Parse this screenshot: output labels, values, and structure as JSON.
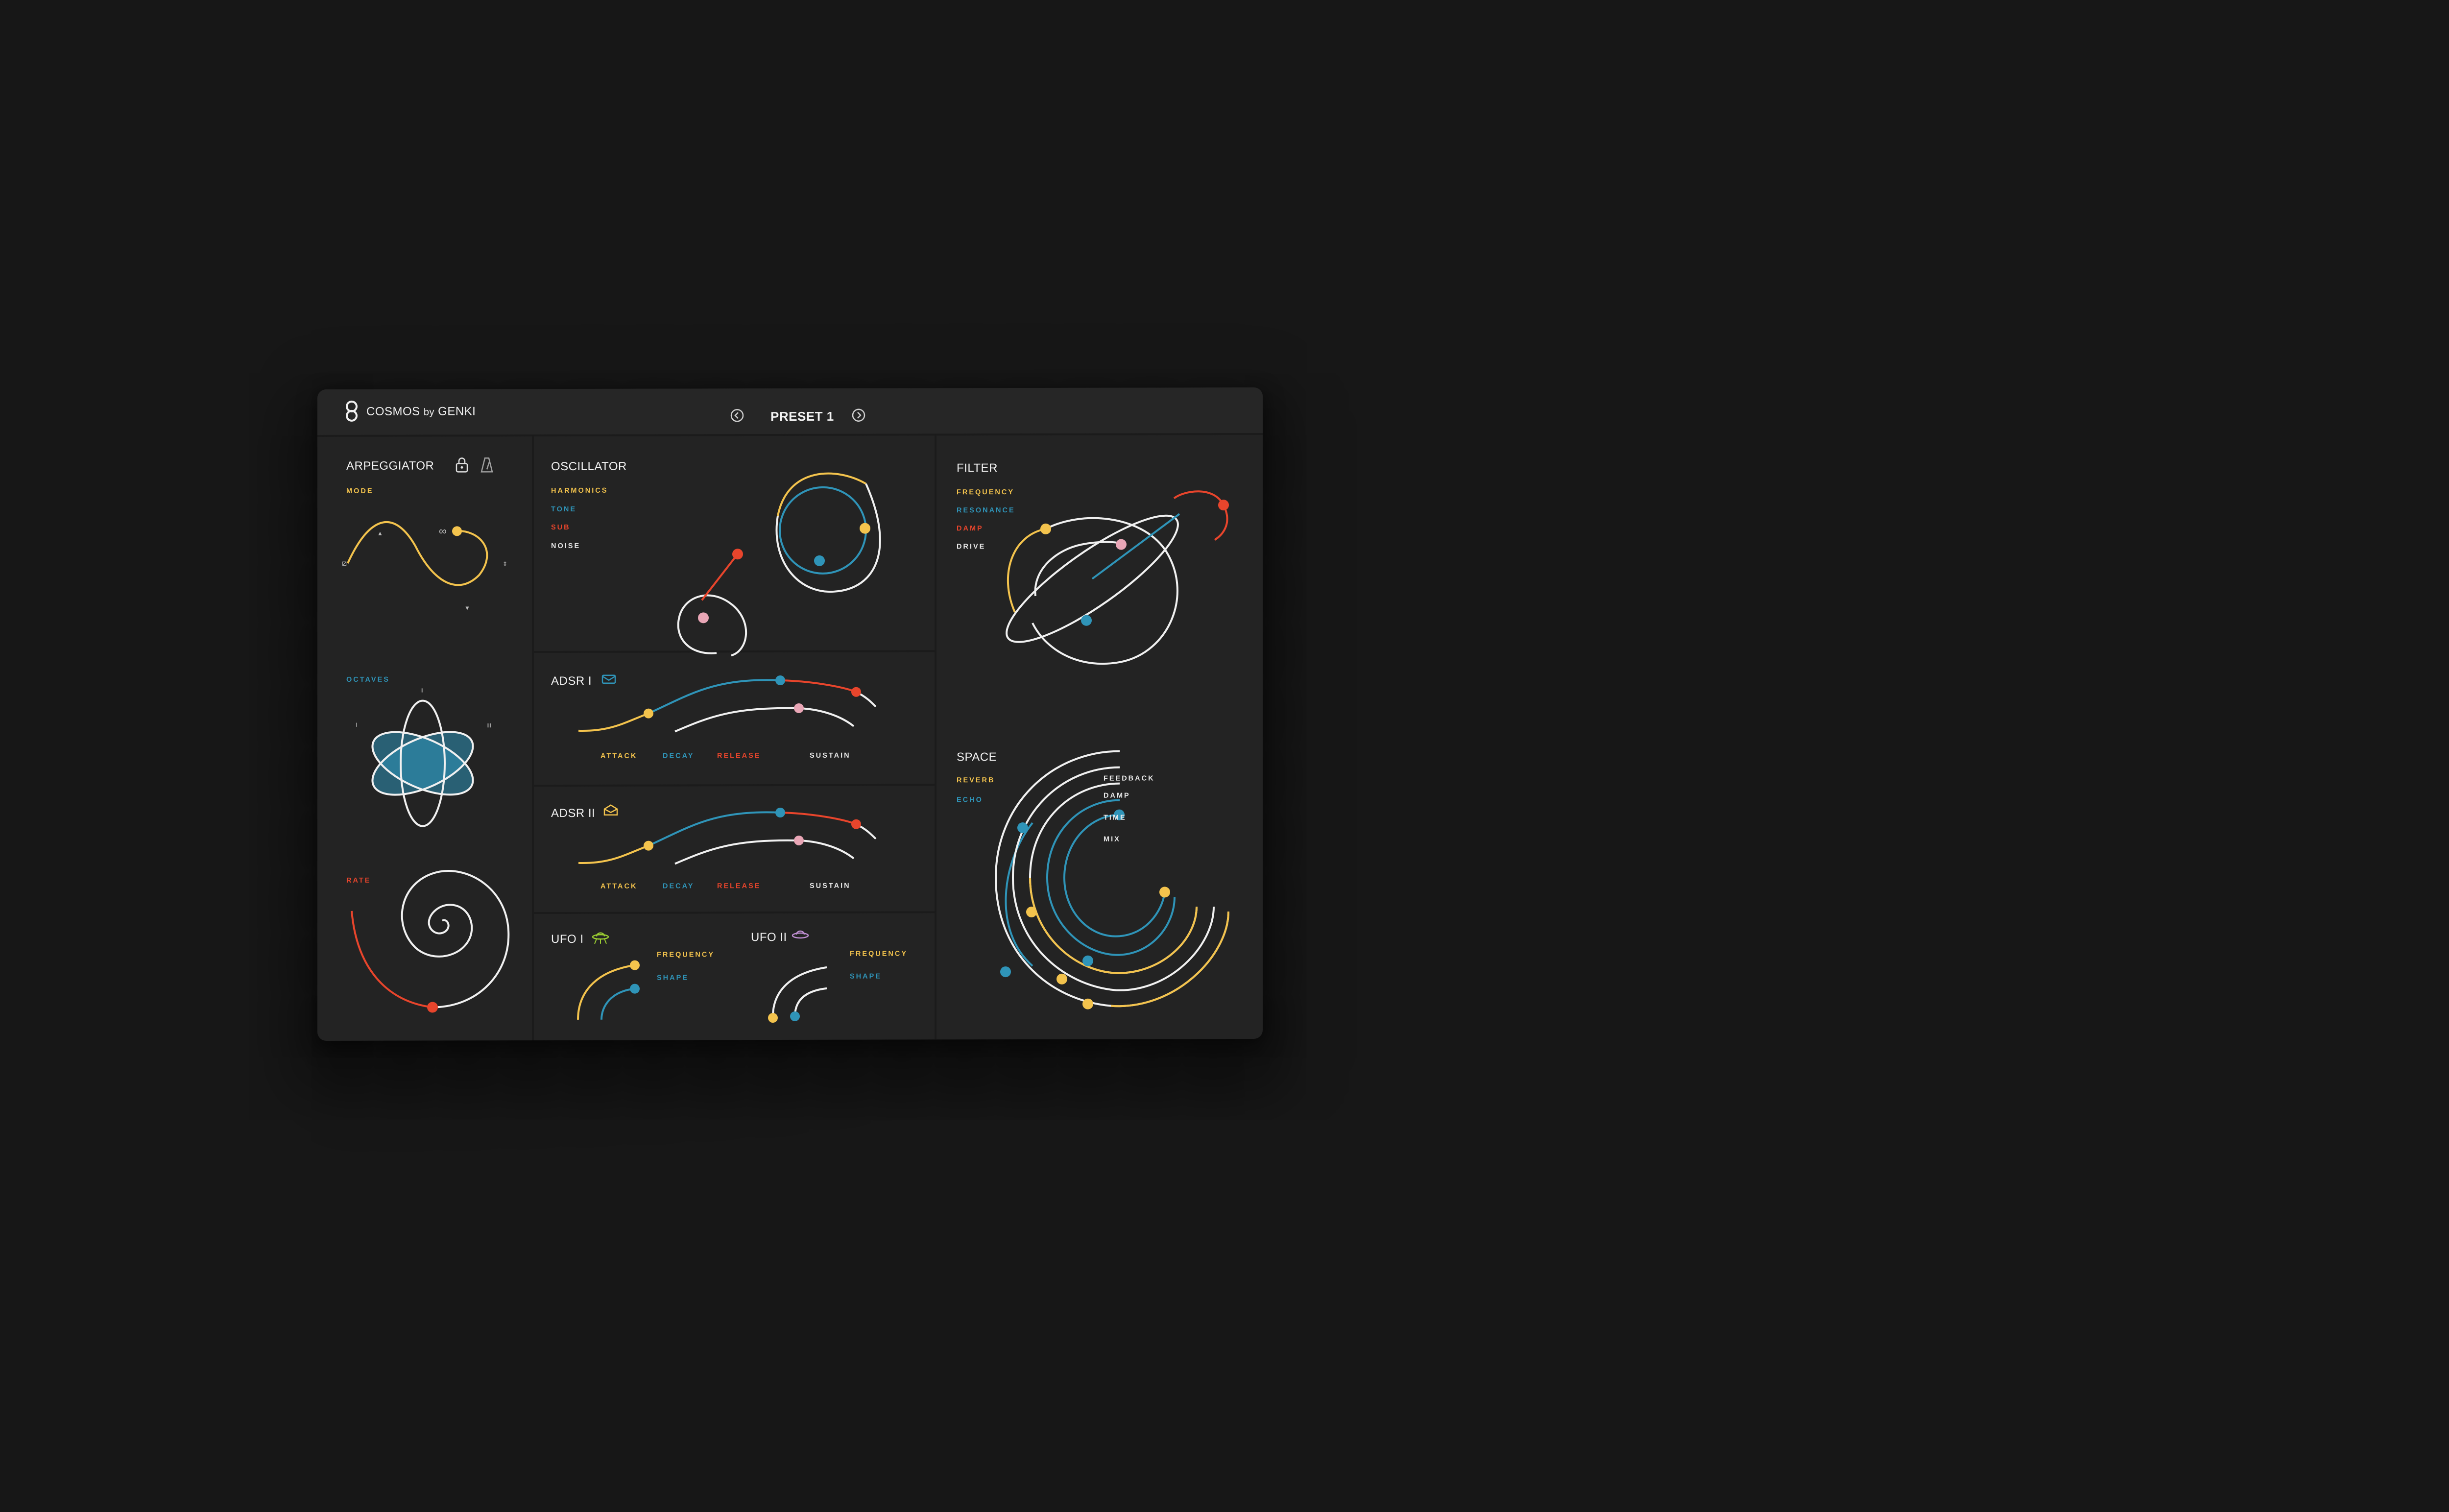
{
  "header": {
    "brand": "COSMOS",
    "brand_by": "by",
    "brand_maker": "GENKI",
    "preset_name": "PRESET 1"
  },
  "colors": {
    "background": "#171717",
    "panel": "#232323",
    "yellow": "#f3c34d",
    "blue": "#2f94b8",
    "red": "#e8452c",
    "pink": "#e9a6b6",
    "white": "#f0f0f0",
    "green": "#9acd32",
    "purple": "#c190d4"
  },
  "arpeggiator": {
    "title": "ARPEGGIATOR",
    "mode_label": "MODE",
    "octaves_label": "OCTAVES",
    "octave_ticks": [
      "I",
      "II",
      "III"
    ],
    "rate_label": "RATE"
  },
  "oscillator": {
    "title": "OSCILLATOR",
    "params": [
      "HARMONICS",
      "TONE",
      "SUB",
      "NOISE"
    ]
  },
  "adsr1": {
    "title": "ADSR I",
    "labels": [
      "ATTACK",
      "DECAY",
      "RELEASE",
      "SUSTAIN"
    ]
  },
  "adsr2": {
    "title": "ADSR II",
    "labels": [
      "ATTACK",
      "DECAY",
      "RELEASE",
      "SUSTAIN"
    ]
  },
  "ufo1": {
    "title": "UFO I",
    "params": [
      "FREQUENCY",
      "SHAPE"
    ]
  },
  "ufo2": {
    "title": "UFO II",
    "params": [
      "FREQUENCY",
      "SHAPE"
    ]
  },
  "filter": {
    "title": "FILTER",
    "params": [
      "FREQUENCY",
      "RESONANCE",
      "DAMP",
      "DRIVE"
    ]
  },
  "space": {
    "title": "SPACE",
    "params": [
      "REVERB",
      "ECHO"
    ],
    "reverb_params": [
      "FEEDBACK",
      "DAMP",
      "TIME",
      "MIX"
    ]
  }
}
